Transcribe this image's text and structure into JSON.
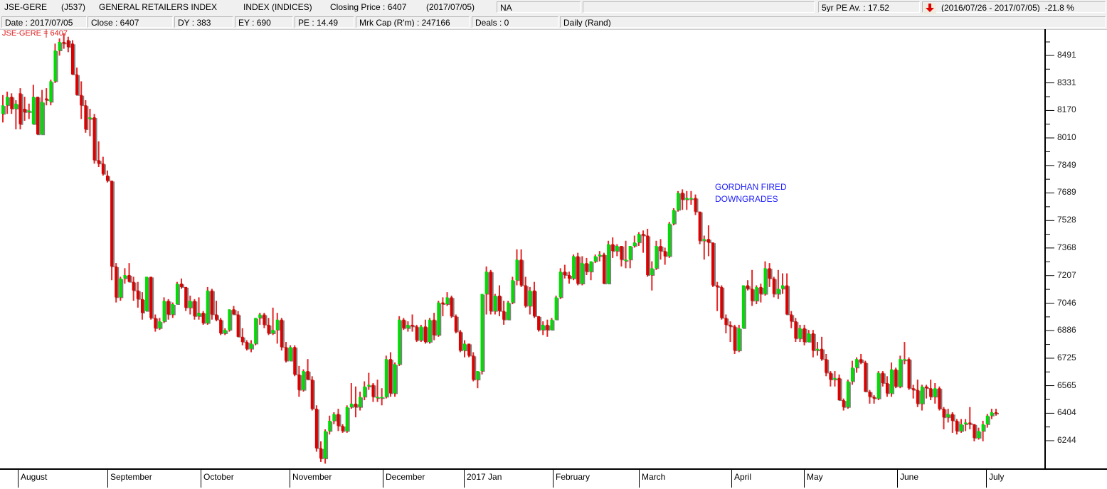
{
  "header": {
    "code": "JSE-GERE",
    "ticker": "(J537)",
    "name": "GENERAL RETAILERS INDEX",
    "type": "INDEX (INDICES)",
    "closing_price": "Closing Price : 6407",
    "closing_date": "(2017/07/05)",
    "status": "NA",
    "blank": "",
    "pe_avg": "5yr PE Av. : 17.52",
    "trend_icon": "down-arrow",
    "trend_color": "#e00000",
    "period_change": "(2016/07/26 - 2017/07/05)  -21.8 %"
  },
  "info": {
    "date": "Date : 2017/07/05",
    "close": "Close : 6407",
    "dy": "DY : 383",
    "ey": "EY : 690",
    "pe": "PE : 14.49",
    "mkt_cap": "Mrk Cap (R'm) : 247166",
    "deals": "Deals : 0",
    "period": "Daily (Rand)"
  },
  "chart_data": {
    "type": "candlestick",
    "title": "JSE-GERE = 6407",
    "annotation": [
      "GORDHAN FIRED",
      "DOWNGRADES"
    ],
    "colors": {
      "up": "#00dd00",
      "down": "#dd0000",
      "shadow": "#555555",
      "annotation": "#2020ff",
      "legend": "#e02020"
    },
    "y_ticks": [
      8491,
      8331,
      8170,
      8010,
      7849,
      7689,
      7528,
      7368,
      7207,
      7046,
      6886,
      6725,
      6565,
      6404,
      6244
    ],
    "ylim": [
      6080,
      8600
    ],
    "x_months": [
      "August",
      "September",
      "October",
      "November",
      "December",
      "2017 Jan",
      "February",
      "March",
      "April",
      "May",
      "June",
      "July"
    ],
    "x_range": [
      "2016/07/26",
      "2017/07/05"
    ],
    "grid": false,
    "ohlc": [
      [
        8150,
        8260,
        8100,
        8200
      ],
      [
        8200,
        8280,
        8150,
        8250
      ],
      [
        8250,
        8270,
        8150,
        8180
      ],
      [
        8180,
        8230,
        8060,
        8210
      ],
      [
        8270,
        8300,
        8060,
        8090
      ],
      [
        8180,
        8250,
        8110,
        8160
      ],
      [
        8160,
        8210,
        8120,
        8170
      ],
      [
        8090,
        8320,
        8090,
        8250
      ],
      [
        8250,
        8250,
        8030,
        8030
      ],
      [
        8030,
        8290,
        8030,
        8220
      ],
      [
        8240,
        8300,
        8200,
        8230
      ],
      [
        8220,
        8350,
        8200,
        8340
      ],
      [
        8340,
        8560,
        8330,
        8520
      ],
      [
        8520,
        8590,
        8490,
        8570
      ],
      [
        8570,
        8620,
        8530,
        8560
      ],
      [
        8580,
        8600,
        8510,
        8540
      ],
      [
        8560,
        8580,
        8400,
        8380
      ],
      [
        8380,
        8420,
        8260,
        8260
      ],
      [
        8260,
        8340,
        8120,
        8200
      ],
      [
        8200,
        8230,
        8040,
        8060
      ],
      [
        8120,
        8180,
        8020,
        8130
      ],
      [
        8130,
        8150,
        7860,
        7880
      ],
      [
        7880,
        7990,
        7840,
        7860
      ],
      [
        7860,
        7900,
        7790,
        7800
      ],
      [
        7790,
        7820,
        7750,
        7760
      ],
      [
        7760,
        7760,
        7180,
        7260
      ],
      [
        7260,
        7280,
        7050,
        7080
      ],
      [
        7080,
        7200,
        7060,
        7190
      ],
      [
        7190,
        7250,
        7160,
        7210
      ],
      [
        7210,
        7280,
        7180,
        7170
      ],
      [
        7170,
        7200,
        7060,
        7120
      ],
      [
        7120,
        7170,
        7020,
        7070
      ],
      [
        7070,
        7110,
        6950,
        6990
      ],
      [
        7000,
        7200,
        7000,
        7200
      ],
      [
        7200,
        7200,
        6950,
        6960
      ],
      [
        6960,
        6980,
        6880,
        6900
      ],
      [
        6900,
        6960,
        6890,
        6940
      ],
      [
        6940,
        7080,
        6930,
        7060
      ],
      [
        7060,
        7070,
        6950,
        6980
      ],
      [
        6980,
        7050,
        6960,
        7040
      ],
      [
        7040,
        7170,
        7040,
        7160
      ],
      [
        7160,
        7190,
        7130,
        7140
      ],
      [
        7140,
        7140,
        7000,
        7020
      ],
      [
        7020,
        7090,
        6980,
        7060
      ],
      [
        7060,
        7070,
        6950,
        6970
      ],
      [
        6970,
        7080,
        6950,
        6990
      ],
      [
        6990,
        7000,
        6920,
        6930
      ],
      [
        6930,
        7140,
        6920,
        7120
      ],
      [
        7120,
        7130,
        6950,
        6980
      ],
      [
        6980,
        7060,
        6940,
        6950
      ],
      [
        6950,
        6960,
        6860,
        6870
      ],
      [
        6870,
        6900,
        6860,
        6890
      ],
      [
        6890,
        7010,
        6880,
        7010
      ],
      [
        7010,
        7030,
        6980,
        6980
      ],
      [
        6980,
        7000,
        6850,
        6850
      ],
      [
        6850,
        6900,
        6800,
        6820
      ],
      [
        6820,
        6830,
        6770,
        6780
      ],
      [
        6780,
        6830,
        6760,
        6810
      ],
      [
        6810,
        6960,
        6800,
        6960
      ],
      [
        6960,
        6990,
        6920,
        6980
      ],
      [
        6980,
        6990,
        6900,
        6920
      ],
      [
        6920,
        6960,
        6860,
        6870
      ],
      [
        6870,
        7020,
        6860,
        6890
      ],
      [
        6890,
        6990,
        6810,
        6950
      ],
      [
        6950,
        6960,
        6770,
        6790
      ],
      [
        6790,
        6820,
        6700,
        6710
      ],
      [
        6710,
        6800,
        6710,
        6790
      ],
      [
        6790,
        6800,
        6620,
        6630
      ],
      [
        6630,
        6680,
        6500,
        6540
      ],
      [
        6540,
        6660,
        6530,
        6650
      ],
      [
        6650,
        6720,
        6600,
        6600
      ],
      [
        6600,
        6620,
        6420,
        6430
      ],
      [
        6430,
        6450,
        6180,
        6200
      ],
      [
        6200,
        6240,
        6120,
        6140
      ],
      [
        6140,
        6310,
        6110,
        6300
      ],
      [
        6300,
        6390,
        6280,
        6360
      ],
      [
        6360,
        6410,
        6340,
        6400
      ],
      [
        6400,
        6430,
        6300,
        6330
      ],
      [
        6330,
        6340,
        6290,
        6300
      ],
      [
        6300,
        6450,
        6290,
        6440
      ],
      [
        6440,
        6580,
        6430,
        6460
      ],
      [
        6460,
        6560,
        6380,
        6440
      ],
      [
        6440,
        6530,
        6420,
        6500
      ],
      [
        6500,
        6590,
        6480,
        6560
      ],
      [
        6560,
        6640,
        6540,
        6570
      ],
      [
        6570,
        6580,
        6470,
        6500
      ],
      [
        6500,
        6600,
        6470,
        6500
      ],
      [
        6500,
        6550,
        6450,
        6500
      ],
      [
        6500,
        6740,
        6490,
        6720
      ],
      [
        6720,
        6760,
        6500,
        6520
      ],
      [
        6520,
        6700,
        6500,
        6690
      ],
      [
        6690,
        6970,
        6680,
        6950
      ],
      [
        6950,
        6960,
        6890,
        6900
      ],
      [
        6900,
        6940,
        6880,
        6920
      ],
      [
        6920,
        6980,
        6880,
        6910
      ],
      [
        6910,
        6920,
        6820,
        6830
      ],
      [
        6830,
        6920,
        6820,
        6910
      ],
      [
        6910,
        6950,
        6810,
        6820
      ],
      [
        6820,
        6960,
        6810,
        6950
      ],
      [
        6950,
        6990,
        6830,
        6860
      ],
      [
        6860,
        7060,
        6850,
        7050
      ],
      [
        7050,
        7080,
        6970,
        7040
      ],
      [
        7040,
        7110,
        7030,
        7080
      ],
      [
        7080,
        7090,
        6960,
        6970
      ],
      [
        6970,
        6980,
        6870,
        6880
      ],
      [
        6880,
        6890,
        6760,
        6770
      ],
      [
        6770,
        6830,
        6730,
        6810
      ],
      [
        6810,
        6810,
        6730,
        6740
      ],
      [
        6740,
        6760,
        6590,
        6600
      ],
      [
        6600,
        6650,
        6550,
        6650
      ],
      [
        6650,
        7100,
        6630,
        7100
      ],
      [
        7100,
        7260,
        6980,
        7230
      ],
      [
        7230,
        7240,
        6980,
        7000
      ],
      [
        7000,
        7100,
        6980,
        7090
      ],
      [
        7090,
        7150,
        6970,
        7000
      ],
      [
        7000,
        7060,
        6920,
        6950
      ],
      [
        6950,
        7060,
        6950,
        7050
      ],
      [
        7050,
        7200,
        7040,
        7180
      ],
      [
        7180,
        7360,
        7150,
        7300
      ],
      [
        7300,
        7360,
        7140,
        7150
      ],
      [
        7150,
        7200,
        7020,
        7030
      ],
      [
        7030,
        7140,
        6980,
        7120
      ],
      [
        7120,
        7170,
        6960,
        6970
      ],
      [
        6970,
        6970,
        6880,
        6890
      ],
      [
        6890,
        6940,
        6860,
        6920
      ],
      [
        6920,
        6950,
        6850,
        6890
      ],
      [
        6890,
        6960,
        6890,
        6950
      ],
      [
        6950,
        7090,
        6950,
        7080
      ],
      [
        7080,
        7250,
        7070,
        7230
      ],
      [
        7230,
        7270,
        7190,
        7210
      ],
      [
        7210,
        7230,
        7160,
        7190
      ],
      [
        7190,
        7330,
        7180,
        7320
      ],
      [
        7320,
        7340,
        7150,
        7160
      ],
      [
        7160,
        7320,
        7150,
        7280
      ],
      [
        7280,
        7310,
        7210,
        7230
      ],
      [
        7230,
        7290,
        7180,
        7290
      ],
      [
        7290,
        7330,
        7280,
        7320
      ],
      [
        7320,
        7350,
        7290,
        7330
      ],
      [
        7330,
        7340,
        7160,
        7160
      ],
      [
        7160,
        7410,
        7160,
        7390
      ],
      [
        7390,
        7430,
        7310,
        7350
      ],
      [
        7350,
        7390,
        7320,
        7380
      ],
      [
        7380,
        7380,
        7260,
        7300
      ],
      [
        7300,
        7410,
        7250,
        7300
      ],
      [
        7300,
        7380,
        7250,
        7380
      ],
      [
        7380,
        7440,
        7370,
        7400
      ],
      [
        7400,
        7460,
        7380,
        7450
      ],
      [
        7450,
        7470,
        7340,
        7440
      ],
      [
        7440,
        7480,
        7200,
        7210
      ],
      [
        7210,
        7290,
        7120,
        7250
      ],
      [
        7250,
        7410,
        7240,
        7380
      ],
      [
        7380,
        7420,
        7300,
        7350
      ],
      [
        7350,
        7370,
        7270,
        7320
      ],
      [
        7320,
        7520,
        7310,
        7510
      ],
      [
        7510,
        7600,
        7500,
        7590
      ],
      [
        7590,
        7700,
        7580,
        7690
      ],
      [
        7690,
        7710,
        7590,
        7650
      ],
      [
        7650,
        7700,
        7590,
        7660
      ],
      [
        7660,
        7700,
        7620,
        7660
      ],
      [
        7660,
        7680,
        7560,
        7580
      ],
      [
        7580,
        7580,
        7390,
        7410
      ],
      [
        7410,
        7440,
        7300,
        7420
      ],
      [
        7420,
        7500,
        7320,
        7400
      ],
      [
        7400,
        7400,
        7140,
        7150
      ],
      [
        7150,
        7170,
        7000,
        7140
      ],
      [
        7140,
        7150,
        6950,
        6960
      ],
      [
        6960,
        6980,
        6870,
        6920
      ],
      [
        6920,
        6940,
        6820,
        6910
      ],
      [
        6910,
        6920,
        6750,
        6770
      ],
      [
        6770,
        6920,
        6760,
        6900
      ],
      [
        6900,
        7150,
        6900,
        7150
      ],
      [
        7150,
        7180,
        7120,
        7130
      ],
      [
        7130,
        7240,
        7030,
        7060
      ],
      [
        7060,
        7150,
        7040,
        7140
      ],
      [
        7140,
        7160,
        7050,
        7100
      ],
      [
        7100,
        7290,
        7090,
        7250
      ],
      [
        7250,
        7280,
        7140,
        7190
      ],
      [
        7190,
        7200,
        7080,
        7100
      ],
      [
        7100,
        7240,
        7070,
        7130
      ],
      [
        7130,
        7220,
        7100,
        7150
      ],
      [
        7150,
        7220,
        6980,
        6980
      ],
      [
        6980,
        7000,
        6900,
        6940
      ],
      [
        6940,
        6960,
        6820,
        6840
      ],
      [
        6840,
        6920,
        6820,
        6900
      ],
      [
        6900,
        6920,
        6800,
        6820
      ],
      [
        6820,
        6890,
        6830,
        6870
      ],
      [
        6870,
        6890,
        6730,
        6770
      ],
      [
        6770,
        6820,
        6740,
        6780
      ],
      [
        6780,
        6850,
        6710,
        6720
      ],
      [
        6720,
        6750,
        6620,
        6640
      ],
      [
        6640,
        6650,
        6560,
        6600
      ],
      [
        6600,
        6650,
        6560,
        6610
      ],
      [
        6610,
        6630,
        6480,
        6480
      ],
      [
        6480,
        6490,
        6420,
        6440
      ],
      [
        6440,
        6600,
        6430,
        6590
      ],
      [
        6590,
        6710,
        6570,
        6670
      ],
      [
        6670,
        6730,
        6640,
        6720
      ],
      [
        6720,
        6750,
        6690,
        6700
      ],
      [
        6700,
        6710,
        6530,
        6530
      ],
      [
        6530,
        6540,
        6460,
        6500
      ],
      [
        6500,
        6510,
        6460,
        6490
      ],
      [
        6490,
        6650,
        6480,
        6640
      ],
      [
        6640,
        6650,
        6560,
        6580
      ],
      [
        6580,
        6620,
        6500,
        6520
      ],
      [
        6520,
        6700,
        6500,
        6660
      ],
      [
        6660,
        6670,
        6550,
        6560
      ],
      [
        6560,
        6740,
        6550,
        6720
      ],
      [
        6720,
        6820,
        6690,
        6720
      ],
      [
        6720,
        6730,
        6540,
        6550
      ],
      [
        6550,
        6570,
        6490,
        6540
      ],
      [
        6540,
        6600,
        6440,
        6460
      ],
      [
        6460,
        6570,
        6420,
        6560
      ],
      [
        6560,
        6570,
        6490,
        6550
      ],
      [
        6550,
        6600,
        6480,
        6500
      ],
      [
        6500,
        6580,
        6460,
        6550
      ],
      [
        6550,
        6560,
        6420,
        6430
      ],
      [
        6430,
        6440,
        6310,
        6380
      ],
      [
        6380,
        6430,
        6350,
        6400
      ],
      [
        6400,
        6410,
        6290,
        6360
      ],
      [
        6360,
        6370,
        6280,
        6300
      ],
      [
        6300,
        6370,
        6290,
        6340
      ],
      [
        6340,
        6370,
        6300,
        6350
      ],
      [
        6350,
        6440,
        6310,
        6340
      ],
      [
        6340,
        6340,
        6240,
        6260
      ],
      [
        6260,
        6320,
        6250,
        6300
      ],
      [
        6300,
        6360,
        6240,
        6340
      ],
      [
        6340,
        6400,
        6320,
        6390
      ],
      [
        6390,
        6430,
        6370,
        6410
      ],
      [
        6410,
        6430,
        6390,
        6407
      ]
    ]
  }
}
